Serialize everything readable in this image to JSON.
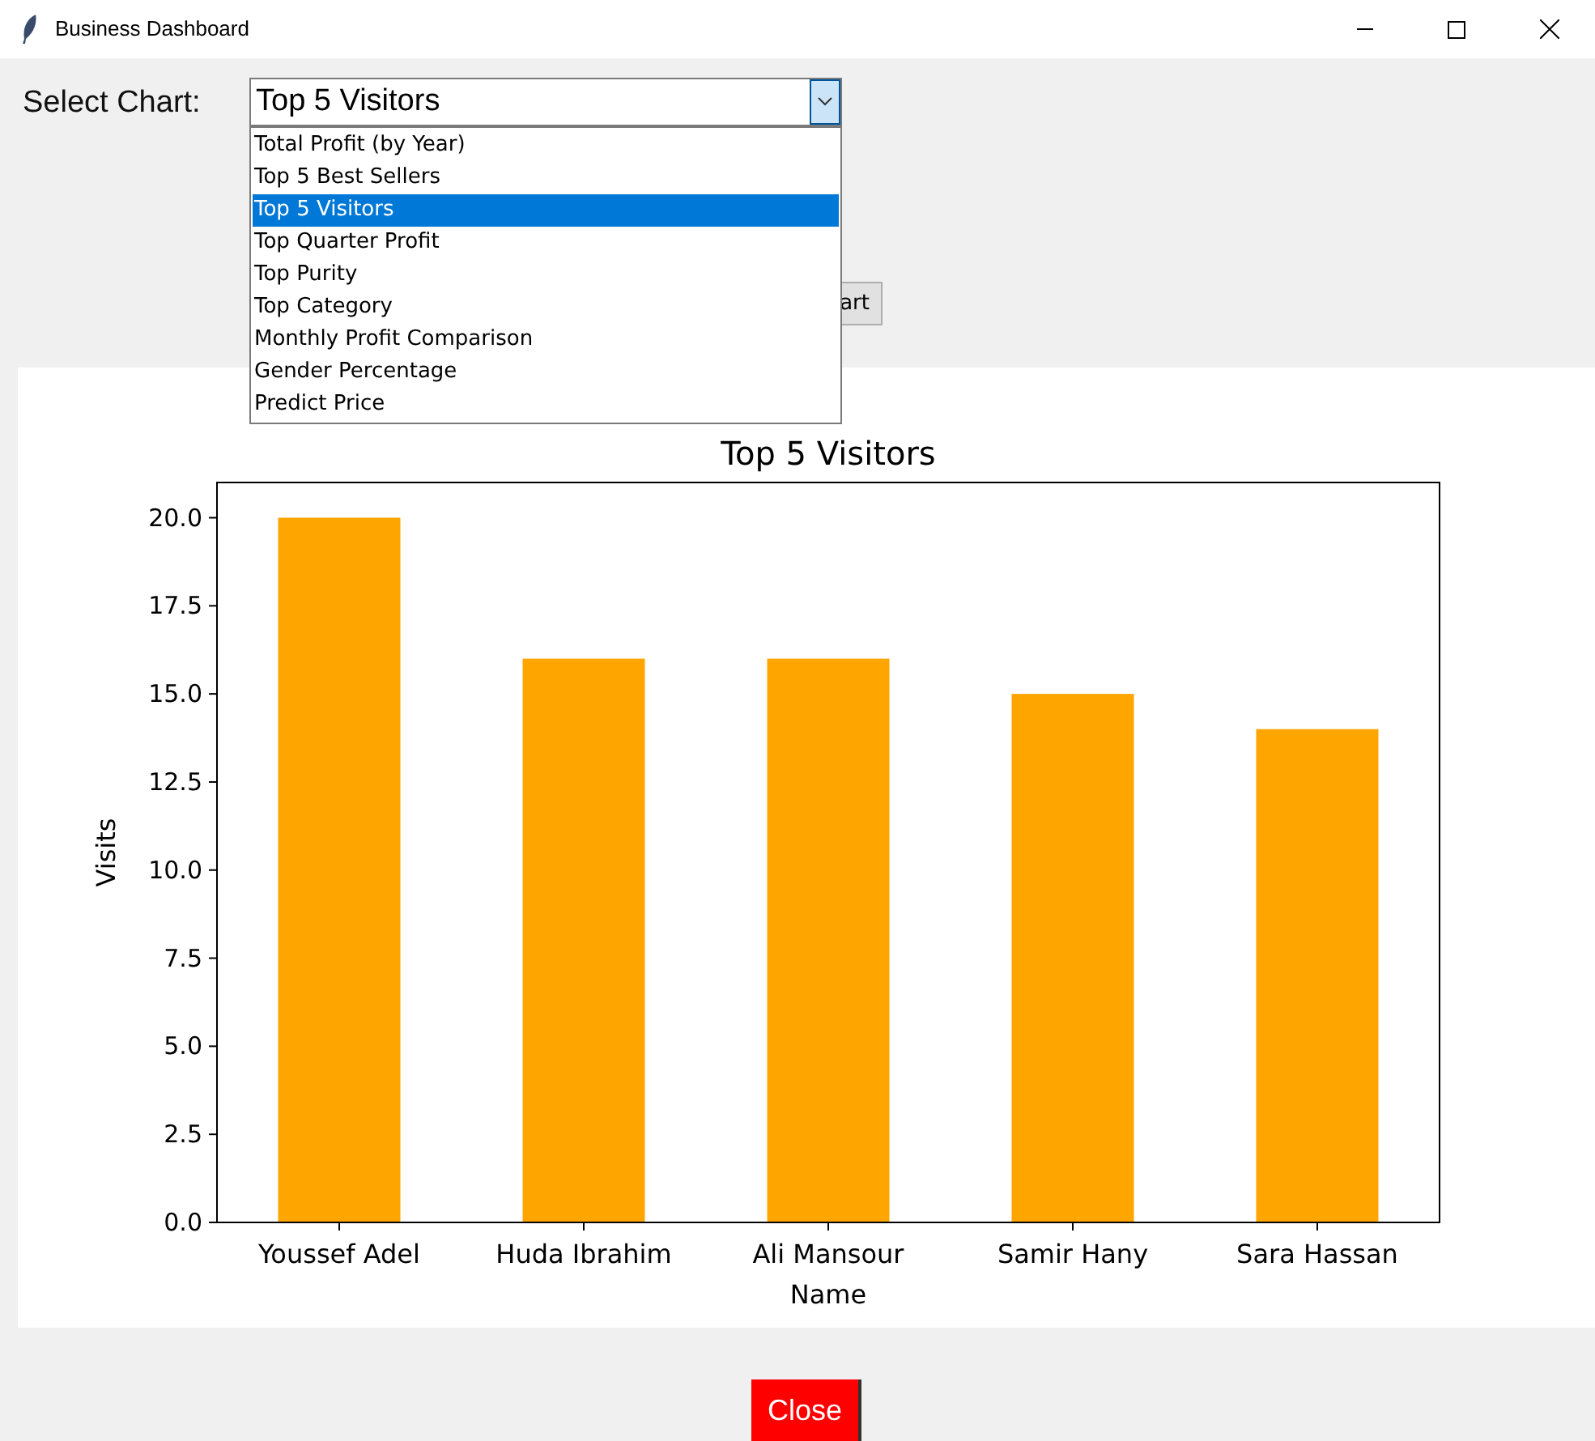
{
  "window": {
    "title": "Business Dashboard"
  },
  "select_label": "Select Chart:",
  "combobox": {
    "value": "Top 5 Visitors",
    "expanded": true,
    "options": [
      {
        "label": "Total Profit (by Year)",
        "selected": false
      },
      {
        "label": "Top 5 Best Sellers",
        "selected": false
      },
      {
        "label": "Top 5 Visitors",
        "selected": true
      },
      {
        "label": "Top Quarter Profit",
        "selected": false
      },
      {
        "label": "Top Purity",
        "selected": false
      },
      {
        "label": "Top Category",
        "selected": false
      },
      {
        "label": "Monthly Profit Comparison",
        "selected": false
      },
      {
        "label": "Gender Percentage",
        "selected": false
      },
      {
        "label": "Predict Price",
        "selected": false
      }
    ]
  },
  "show_button": "art",
  "chart": {
    "chart_data": {
      "type": "bar",
      "title": "Top 5 Visitors",
      "xlabel": "Name",
      "ylabel": "Visits",
      "categories": [
        "Youssef Adel",
        "Huda Ibrahim",
        "Ali Mansour",
        "Samir Hany",
        "Sara Hassan"
      ],
      "series": [
        {
          "color": "#ffa500",
          "values": [
            20,
            16,
            16,
            15,
            14
          ]
        }
      ],
      "ylim": [
        0,
        21
      ],
      "yticks": [
        {
          "value": 0,
          "label": "0.0"
        },
        {
          "value": 2.5,
          "label": "2.5"
        },
        {
          "value": 5,
          "label": "5.0"
        },
        {
          "value": 7.5,
          "label": "7.5"
        },
        {
          "value": 10,
          "label": "10.0"
        },
        {
          "value": 12.5,
          "label": "12.5"
        },
        {
          "value": 15,
          "label": "15.0"
        },
        {
          "value": 17.5,
          "label": "17.5"
        },
        {
          "value": 20,
          "label": "20.0"
        }
      ]
    }
  },
  "close_button": "Close"
}
